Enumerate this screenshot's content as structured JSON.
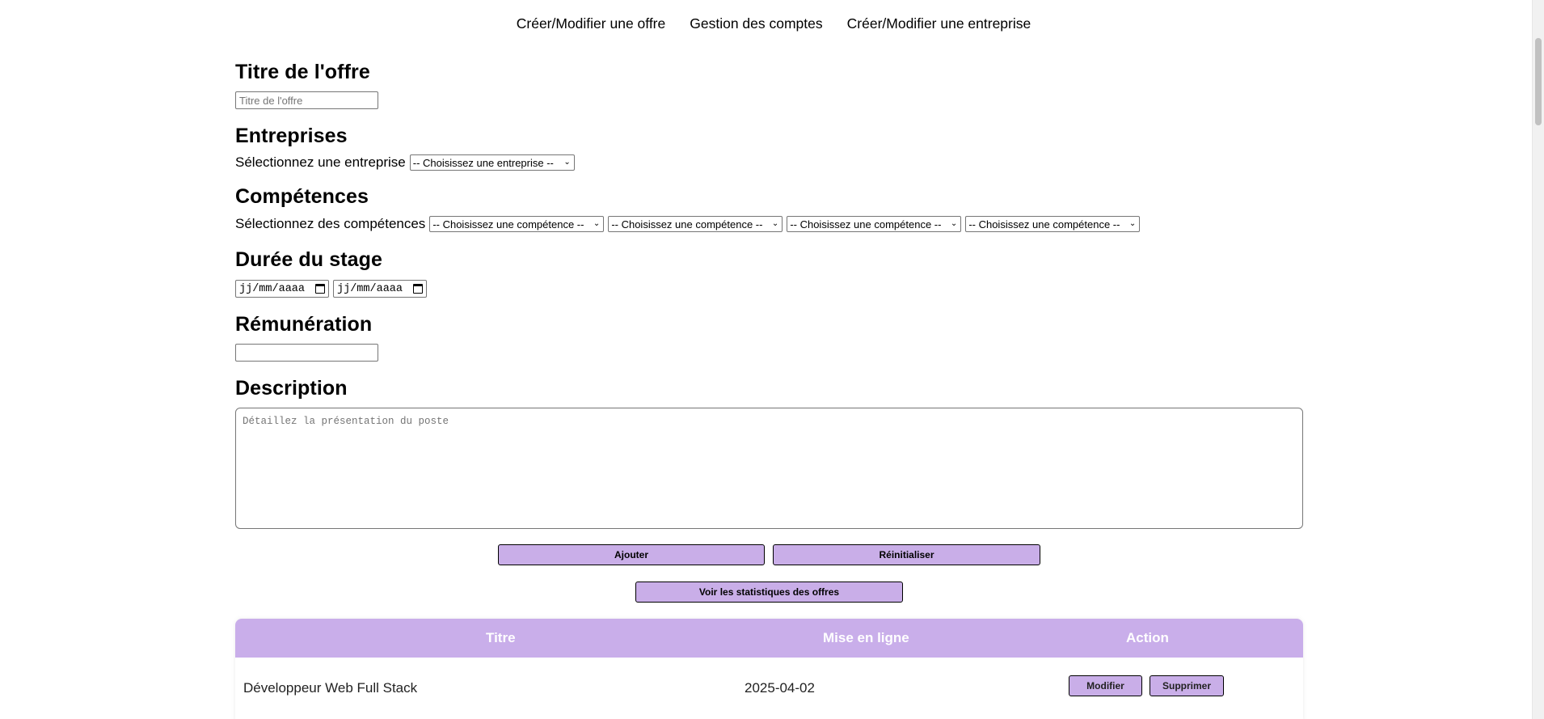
{
  "nav": {
    "items": [
      {
        "label": "Créer/Modifier une offre"
      },
      {
        "label": "Gestion des comptes"
      },
      {
        "label": "Créer/Modifier une entreprise"
      }
    ]
  },
  "form": {
    "titre": {
      "heading": "Titre de l'offre",
      "placeholder": "Titre de l'offre",
      "value": ""
    },
    "entreprises": {
      "heading": "Entreprises",
      "label": "Sélectionnez une entreprise",
      "selected": "-- Choisissez une entreprise --"
    },
    "competences": {
      "heading": "Compétences",
      "label": "Sélectionnez des compétences",
      "selects": [
        {
          "selected": "-- Choisissez une compétence --"
        },
        {
          "selected": "-- Choisissez une compétence --"
        },
        {
          "selected": "-- Choisissez une compétence --"
        },
        {
          "selected": "-- Choisissez une compétence --"
        }
      ]
    },
    "duree": {
      "heading": "Durée du stage",
      "start_placeholder": "jj/mm/aaaa",
      "end_placeholder": "jj/mm/aaaa"
    },
    "remuneration": {
      "heading": "Rémunération",
      "value": ""
    },
    "description": {
      "heading": "Description",
      "placeholder": "Détaillez la présentation du poste"
    }
  },
  "buttons": {
    "ajouter": "Ajouter",
    "reinitialiser": "Réinitialiser",
    "statistiques": "Voir les statistiques des offres"
  },
  "table": {
    "headers": {
      "titre": "Titre",
      "mise_en_ligne": "Mise en ligne",
      "action": "Action"
    },
    "rows": [
      {
        "titre": "Développeur Web Full Stack",
        "mise_en_ligne": "2025-04-02",
        "modifier": "Modifier",
        "supprimer": "Supprimer"
      }
    ]
  },
  "colors": {
    "accent": "#c9aee8",
    "header_text": "#ffffff"
  }
}
